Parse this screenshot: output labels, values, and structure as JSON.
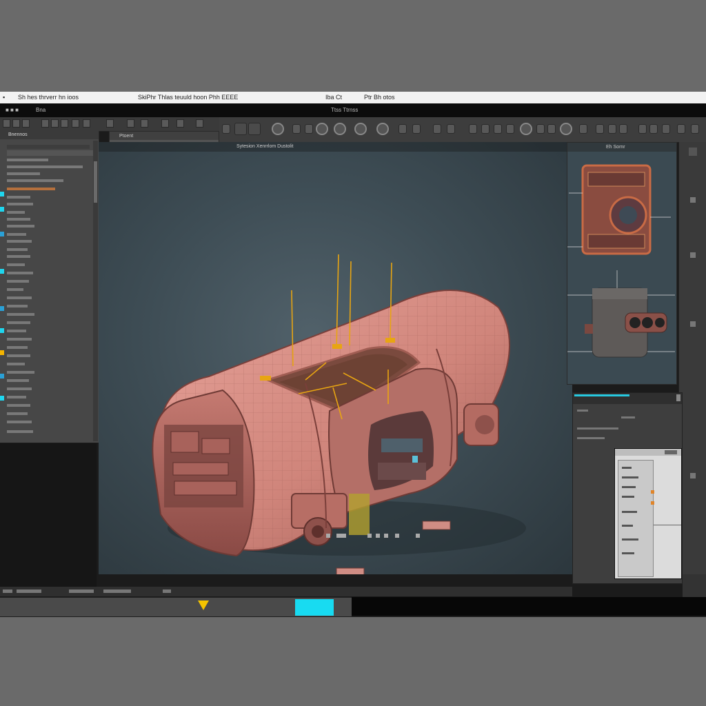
{
  "window": {
    "title_segments": [
      "Sh  hes  thrverr  hn  ioos",
      "SkiPhr  Thlas  teuuld hoon  Phh  EEEE",
      "Iba  Ct",
      "Ptr  Bh  otos"
    ],
    "menu_left": "Bna",
    "menu_center": "Ttss  Ttrnss"
  },
  "outliner": {
    "header": "Bnennos"
  },
  "attributes": {
    "header": "Ptoent"
  },
  "viewport": {
    "header": "Sytesion  Xenrrlom  Dustolit"
  },
  "reference": {
    "header": "Eh  Sornr"
  },
  "colors": {
    "accent": "#1fd6ee",
    "keyframe": "#f4c400",
    "model": "#d9897f",
    "gizmo": "#e8a512"
  },
  "icons": [
    "move-icon",
    "rotate-icon",
    "scale-icon",
    "camera-icon",
    "light-icon",
    "render-icon",
    "snap-icon",
    "grid-icon",
    "wireframe-icon",
    "shading-icon",
    "key-icon",
    "play-icon",
    "settings-icon",
    "render-settings-icon"
  ]
}
